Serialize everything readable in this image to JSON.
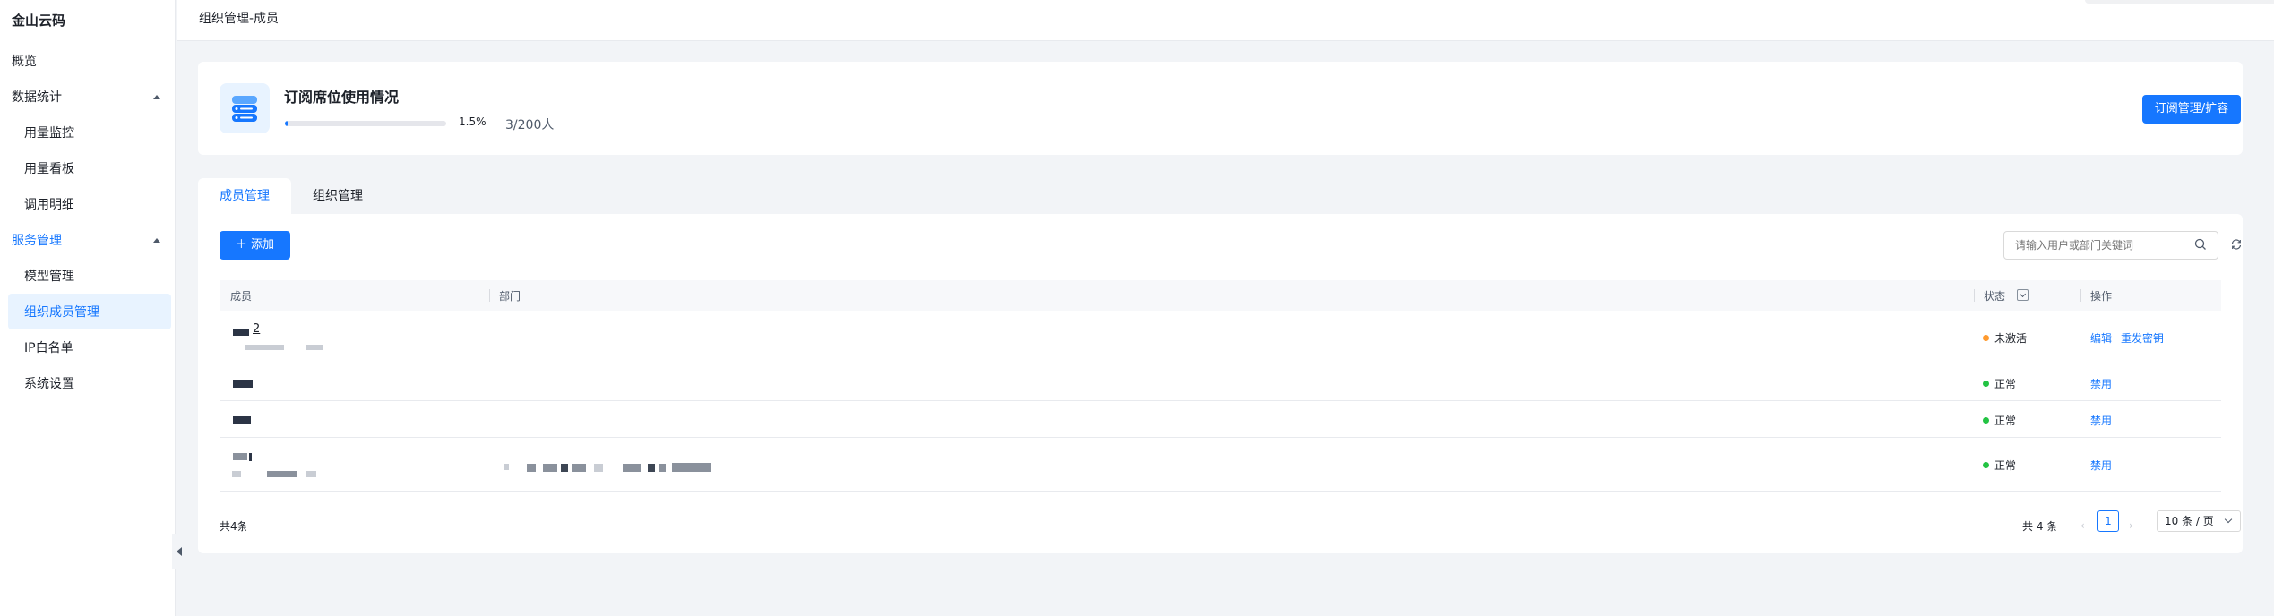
{
  "brand": "金山云码",
  "sidebar": {
    "overview": "概览",
    "data_stats": {
      "label": "数据统计",
      "items": [
        "用量监控",
        "用量看板",
        "调用明细"
      ]
    },
    "service_mgmt": {
      "label": "服务管理",
      "items": [
        "模型管理",
        "组织成员管理",
        "IP白名单",
        "系统设置"
      ],
      "active_index": 1
    }
  },
  "header": {
    "breadcrumb": "组织管理-成员"
  },
  "subscription": {
    "title": "订阅席位使用情况",
    "progress_percent": 1.5,
    "progress_label": "1.5%",
    "seats": "3/200人",
    "expand_button": "订阅管理/扩容"
  },
  "tabs": [
    "成员管理",
    "组织管理"
  ],
  "toolbar": {
    "add_button": "＋ 添加",
    "search_placeholder": "请输入用户或部门关键词"
  },
  "table": {
    "columns": [
      "成员",
      "部门",
      "状态",
      "操作"
    ],
    "rows": [
      {
        "name_suffix": "2",
        "status": "未激活",
        "status_color": "#ff9a2e",
        "actions": [
          "编辑",
          "重发密钥"
        ]
      },
      {
        "status": "正常",
        "status_color": "#23c343",
        "actions": [
          "禁用"
        ]
      },
      {
        "status": "正常",
        "status_color": "#23c343",
        "actions": [
          "禁用"
        ]
      },
      {
        "status": "正常",
        "status_color": "#23c343",
        "actions": [
          "禁用"
        ]
      }
    ]
  },
  "footer": {
    "total_left": "共4条",
    "total_right": "共 4 条",
    "current_page": "1",
    "page_size": "10 条 / 页"
  },
  "colors": {
    "accent": "#1677ff",
    "warning": "#ff9a2e",
    "success": "#23c343"
  }
}
